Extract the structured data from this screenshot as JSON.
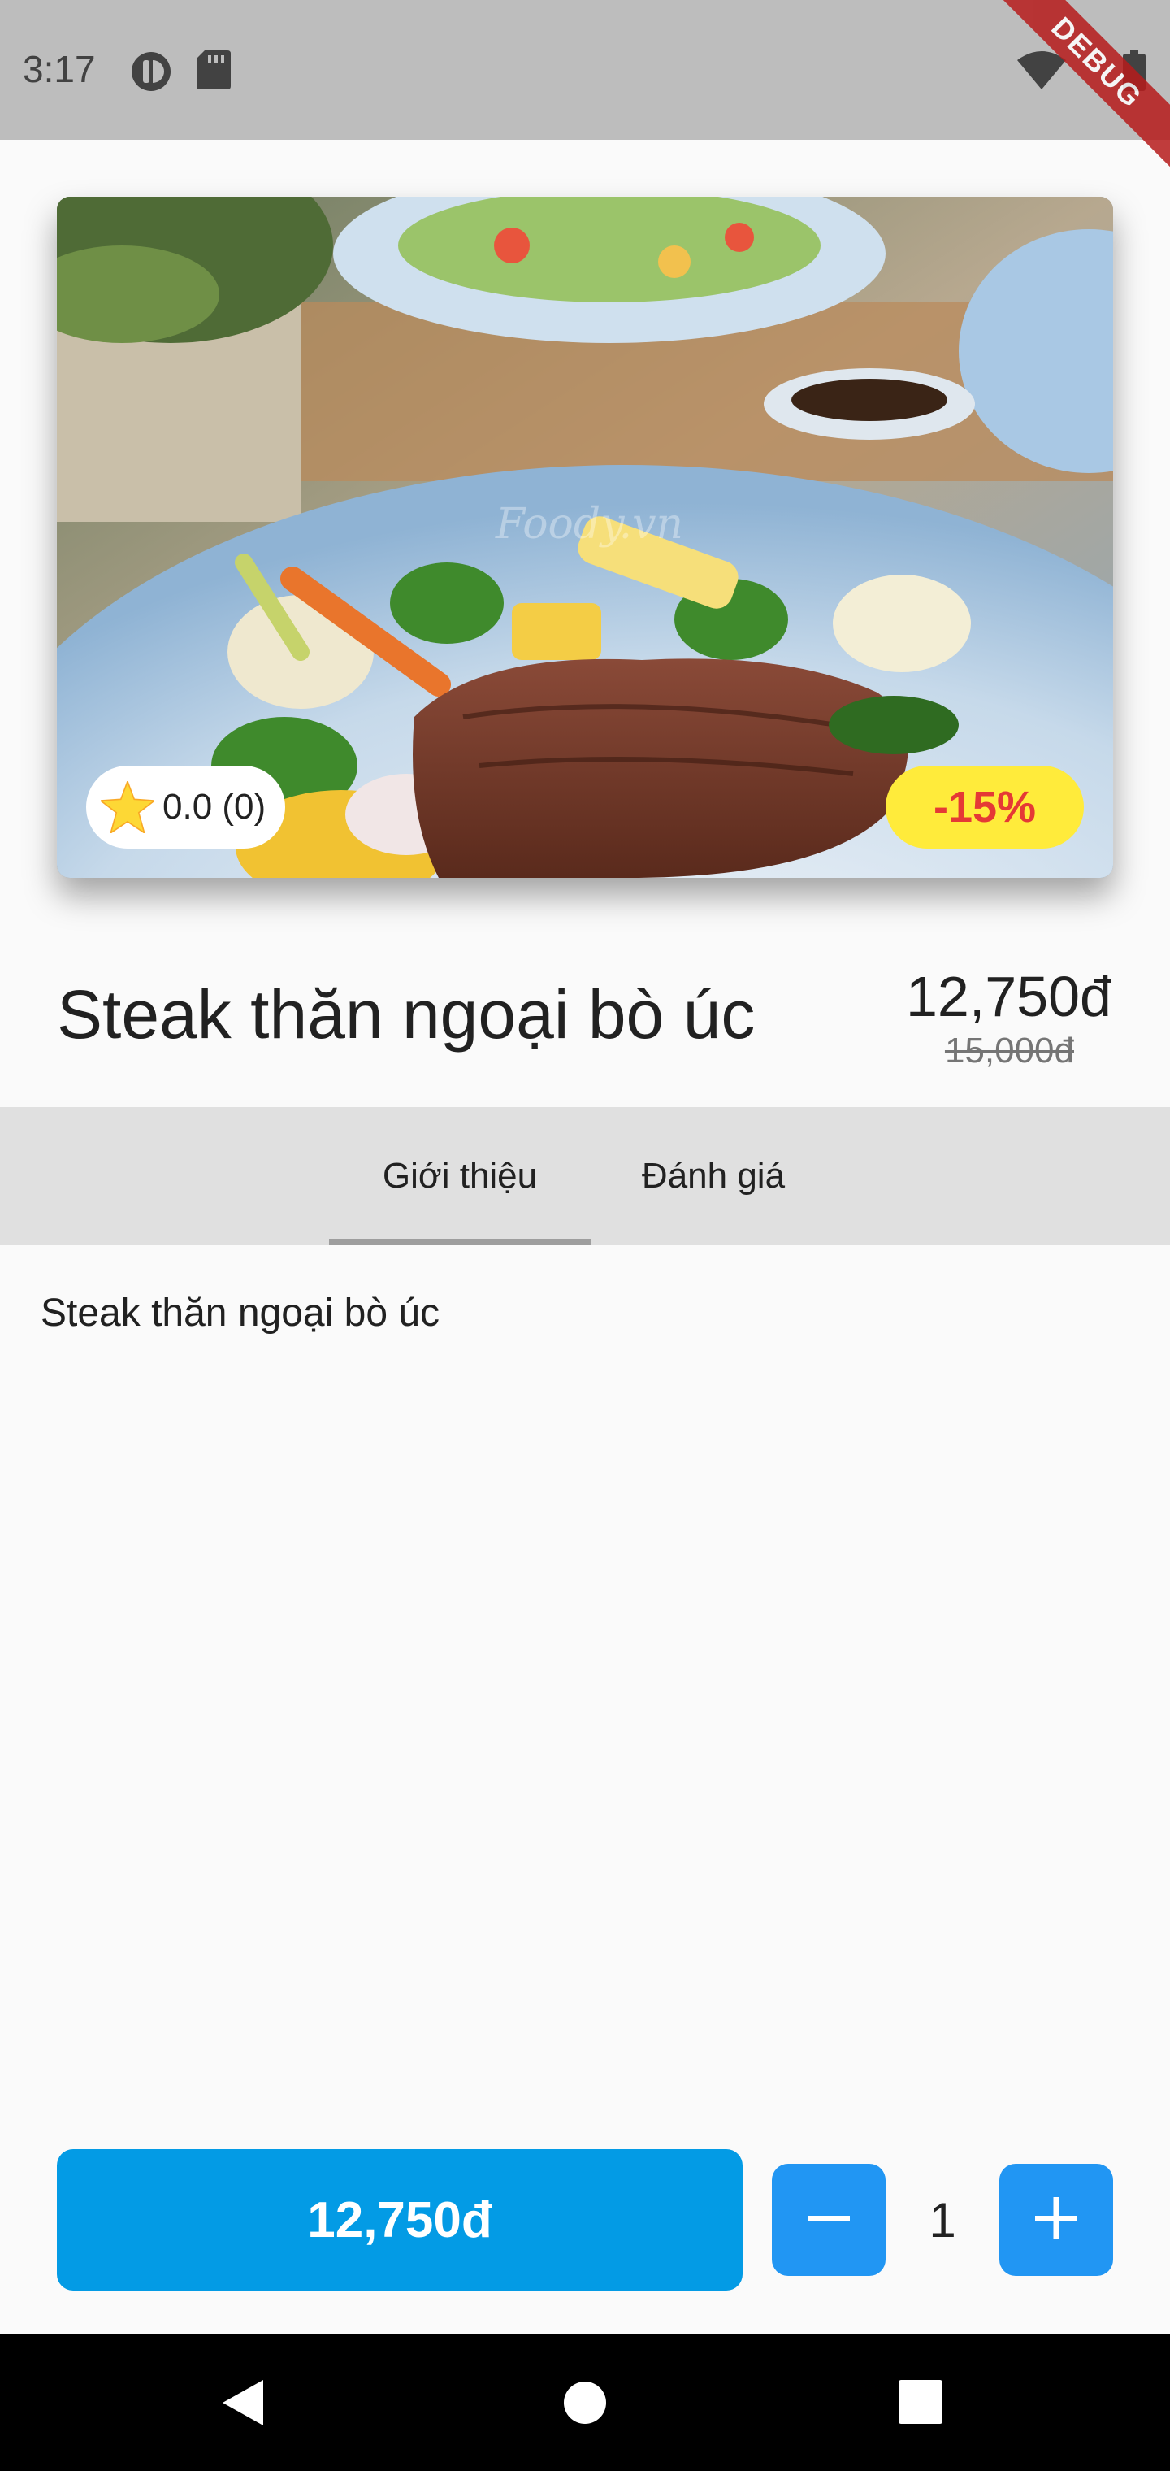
{
  "status_bar": {
    "time": "3:17",
    "debug_label": "DEBUG"
  },
  "product": {
    "name": "Steak thăn ngoại bò úc",
    "price": "12,750đ",
    "original_price": "15,000đ",
    "rating": "0.0 (0)",
    "discount": "-15%",
    "image_watermark": "Foody.vn"
  },
  "tabs": [
    {
      "label": "Giới thiệu",
      "selected": true
    },
    {
      "label": "Đánh giá",
      "selected": false
    }
  ],
  "intro": {
    "text": "Steak thăn ngoại bò úc"
  },
  "cart": {
    "total_label": "12,750đ",
    "quantity": "1"
  },
  "colors": {
    "primary": "#039be5",
    "qty_button": "#2196f3",
    "discount_bg": "#ffeb3b",
    "discount_text": "#e53935",
    "star": "#fdd835"
  },
  "icons": [
    "wifi-icon",
    "battery-icon",
    "star-icon",
    "minus-icon",
    "plus-icon",
    "back-icon",
    "home-icon",
    "recents-icon"
  ]
}
